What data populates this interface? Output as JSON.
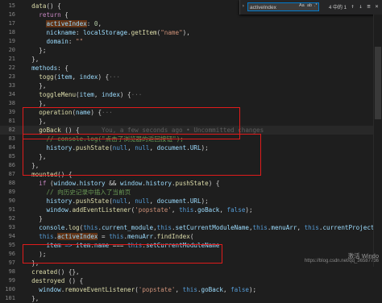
{
  "find": {
    "query": "activeIndex",
    "count": "4 中的 1",
    "opt_case": "Aa",
    "opt_word": "ab",
    "opt_regex": ".*",
    "prev": "↑",
    "next": "↓",
    "toggle_sel": "≡",
    "close": "×"
  },
  "lines": [
    {
      "n": "15",
      "tokens": [
        {
          "t": "  "
        },
        {
          "t": "data",
          "c": "fn"
        },
        {
          "t": "() {"
        }
      ]
    },
    {
      "n": "16",
      "tokens": [
        {
          "t": "    "
        },
        {
          "t": "return",
          "c": "kw"
        },
        {
          "t": " {"
        }
      ]
    },
    {
      "n": "17",
      "tokens": [
        {
          "t": "      "
        },
        {
          "t": "activeIndex",
          "c": "hl"
        },
        {
          "t": ": "
        },
        {
          "t": "0",
          "c": "num"
        },
        {
          "t": ","
        }
      ]
    },
    {
      "n": "18",
      "tokens": [
        {
          "t": "      "
        },
        {
          "t": "nickname",
          "c": "prop"
        },
        {
          "t": ": "
        },
        {
          "t": "localStorage",
          "c": "prop"
        },
        {
          "t": "."
        },
        {
          "t": "getItem",
          "c": "fn"
        },
        {
          "t": "("
        },
        {
          "t": "\"name\"",
          "c": "str"
        },
        {
          "t": "),"
        }
      ]
    },
    {
      "n": "19",
      "tokens": [
        {
          "t": "      "
        },
        {
          "t": "domain",
          "c": "prop"
        },
        {
          "t": ": "
        },
        {
          "t": "\"\"",
          "c": "str"
        }
      ]
    },
    {
      "n": "20",
      "tokens": [
        {
          "t": "    };"
        }
      ]
    },
    {
      "n": "21",
      "tokens": [
        {
          "t": "  },"
        }
      ]
    },
    {
      "n": "22",
      "tokens": [
        {
          "t": "  "
        },
        {
          "t": "methods",
          "c": "prop"
        },
        {
          "t": ": {"
        }
      ]
    },
    {
      "n": "23",
      "tokens": [
        {
          "t": "    "
        },
        {
          "t": "togg",
          "c": "fn"
        },
        {
          "t": "("
        },
        {
          "t": "item",
          "c": "prop"
        },
        {
          "t": ", "
        },
        {
          "t": "index",
          "c": "prop"
        },
        {
          "t": ") {"
        },
        {
          "t": "···",
          "c": "fold"
        }
      ]
    },
    {
      "n": "33",
      "tokens": [
        {
          "t": "    },"
        }
      ]
    },
    {
      "n": "34",
      "tokens": [
        {
          "t": "    "
        },
        {
          "t": "toggleMenu",
          "c": "fn"
        },
        {
          "t": "("
        },
        {
          "t": "item",
          "c": "prop"
        },
        {
          "t": ", "
        },
        {
          "t": "index",
          "c": "prop"
        },
        {
          "t": ") {"
        },
        {
          "t": "···",
          "c": "fold"
        }
      ]
    },
    {
      "n": "38",
      "tokens": [
        {
          "t": "    },"
        }
      ]
    },
    {
      "n": "39",
      "tokens": [
        {
          "t": "    "
        },
        {
          "t": "operation",
          "c": "fn"
        },
        {
          "t": "("
        },
        {
          "t": "name",
          "c": "prop"
        },
        {
          "t": ") {"
        },
        {
          "t": "···",
          "c": "fold"
        }
      ]
    },
    {
      "n": "81",
      "tokens": [
        {
          "t": "    },"
        }
      ]
    },
    {
      "n": "82",
      "tokens": [
        {
          "t": "    "
        },
        {
          "t": "goBack",
          "c": "fn"
        },
        {
          "t": " () {"
        },
        {
          "t": "      You, a few seconds ago • Uncommitted changes",
          "c": "blame"
        }
      ],
      "current": true
    },
    {
      "n": "83",
      "tokens": [
        {
          "t": "      "
        },
        {
          "t": "// console.log(\"点击了浏览器的返回按钮\");",
          "c": "cm"
        }
      ]
    },
    {
      "n": "84",
      "tokens": [
        {
          "t": "      "
        },
        {
          "t": "history",
          "c": "prop"
        },
        {
          "t": "."
        },
        {
          "t": "pushState",
          "c": "fn"
        },
        {
          "t": "("
        },
        {
          "t": "null",
          "c": "kb"
        },
        {
          "t": ", "
        },
        {
          "t": "null",
          "c": "kb"
        },
        {
          "t": ", "
        },
        {
          "t": "document",
          "c": "prop"
        },
        {
          "t": "."
        },
        {
          "t": "URL",
          "c": "prop"
        },
        {
          "t": ");"
        }
      ]
    },
    {
      "n": "85",
      "tokens": [
        {
          "t": "    },"
        }
      ]
    },
    {
      "n": "86",
      "tokens": [
        {
          "t": "  },"
        }
      ]
    },
    {
      "n": "87",
      "tokens": [
        {
          "t": "  "
        },
        {
          "t": "mounted",
          "c": "fn"
        },
        {
          "t": "() {"
        }
      ]
    },
    {
      "n": "88",
      "tokens": [
        {
          "t": "    "
        },
        {
          "t": "if",
          "c": "kw"
        },
        {
          "t": " ("
        },
        {
          "t": "window",
          "c": "prop"
        },
        {
          "t": "."
        },
        {
          "t": "history",
          "c": "prop"
        },
        {
          "t": " && "
        },
        {
          "t": "window",
          "c": "prop"
        },
        {
          "t": "."
        },
        {
          "t": "history",
          "c": "prop"
        },
        {
          "t": "."
        },
        {
          "t": "pushState",
          "c": "fn"
        },
        {
          "t": ") {"
        }
      ]
    },
    {
      "n": "89",
      "tokens": [
        {
          "t": "      "
        },
        {
          "t": "// 向历史记录中插入了当前页",
          "c": "cm"
        }
      ]
    },
    {
      "n": "90",
      "tokens": [
        {
          "t": "      "
        },
        {
          "t": "history",
          "c": "prop"
        },
        {
          "t": "."
        },
        {
          "t": "pushState",
          "c": "fn"
        },
        {
          "t": "("
        },
        {
          "t": "null",
          "c": "kb"
        },
        {
          "t": ", "
        },
        {
          "t": "null",
          "c": "kb"
        },
        {
          "t": ", "
        },
        {
          "t": "document",
          "c": "prop"
        },
        {
          "t": "."
        },
        {
          "t": "URL",
          "c": "prop"
        },
        {
          "t": ");"
        }
      ]
    },
    {
      "n": "91",
      "tokens": [
        {
          "t": "      "
        },
        {
          "t": "window",
          "c": "prop"
        },
        {
          "t": "."
        },
        {
          "t": "addEventListener",
          "c": "fn"
        },
        {
          "t": "("
        },
        {
          "t": "'popstate'",
          "c": "str"
        },
        {
          "t": ", "
        },
        {
          "t": "this",
          "c": "kb"
        },
        {
          "t": "."
        },
        {
          "t": "goBack",
          "c": "prop"
        },
        {
          "t": ", "
        },
        {
          "t": "false",
          "c": "kb"
        },
        {
          "t": ");"
        }
      ]
    },
    {
      "n": "92",
      "tokens": [
        {
          "t": "    }"
        }
      ]
    },
    {
      "n": "93",
      "tokens": [
        {
          "t": "    "
        },
        {
          "t": "console",
          "c": "prop"
        },
        {
          "t": "."
        },
        {
          "t": "log",
          "c": "fn"
        },
        {
          "t": "("
        },
        {
          "t": "this",
          "c": "kb"
        },
        {
          "t": "."
        },
        {
          "t": "current_module",
          "c": "prop"
        },
        {
          "t": ","
        },
        {
          "t": "this",
          "c": "kb"
        },
        {
          "t": "."
        },
        {
          "t": "setCurrentModuleName",
          "c": "prop"
        },
        {
          "t": ","
        },
        {
          "t": "this",
          "c": "kb"
        },
        {
          "t": "."
        },
        {
          "t": "menuArr",
          "c": "prop"
        },
        {
          "t": ", "
        },
        {
          "t": "this",
          "c": "kb"
        },
        {
          "t": "."
        },
        {
          "t": "currentProject",
          "c": "prop"
        },
        {
          "t": ");"
        }
      ]
    },
    {
      "n": "94",
      "tokens": [
        {
          "t": "    "
        },
        {
          "t": "this",
          "c": "kb"
        },
        {
          "t": "."
        },
        {
          "t": "activeIndex",
          "c": "hl"
        },
        {
          "t": " = "
        },
        {
          "t": "this",
          "c": "kb"
        },
        {
          "t": "."
        },
        {
          "t": "menuArr",
          "c": "prop"
        },
        {
          "t": "."
        },
        {
          "t": "findIndex",
          "c": "fn"
        },
        {
          "t": "("
        }
      ]
    },
    {
      "n": "95",
      "tokens": [
        {
          "t": "      "
        },
        {
          "t": "item",
          "c": "prop"
        },
        {
          "t": " "
        },
        {
          "t": "=>",
          "c": "kb"
        },
        {
          "t": " "
        },
        {
          "t": "item",
          "c": "prop"
        },
        {
          "t": "."
        },
        {
          "t": "name",
          "c": "prop"
        },
        {
          "t": " === "
        },
        {
          "t": "this",
          "c": "kb"
        },
        {
          "t": "."
        },
        {
          "t": "setCurrentModuleName",
          "c": "prop"
        }
      ]
    },
    {
      "n": "96",
      "tokens": [
        {
          "t": "    );"
        }
      ]
    },
    {
      "n": "97",
      "tokens": [
        {
          "t": "  },"
        }
      ]
    },
    {
      "n": "98",
      "tokens": [
        {
          "t": "  "
        },
        {
          "t": "created",
          "c": "fn"
        },
        {
          "t": "() {},"
        }
      ]
    },
    {
      "n": "99",
      "tokens": [
        {
          "t": "  "
        },
        {
          "t": "destroyed",
          "c": "fn"
        },
        {
          "t": " () {"
        }
      ]
    },
    {
      "n": "100",
      "tokens": [
        {
          "t": "    "
        },
        {
          "t": "window",
          "c": "prop"
        },
        {
          "t": "."
        },
        {
          "t": "removeEventListener",
          "c": "fn"
        },
        {
          "t": "("
        },
        {
          "t": "'popstate'",
          "c": "str"
        },
        {
          "t": ", "
        },
        {
          "t": "this",
          "c": "kb"
        },
        {
          "t": "."
        },
        {
          "t": "goBack",
          "c": "prop"
        },
        {
          "t": ", "
        },
        {
          "t": "false",
          "c": "kb"
        },
        {
          "t": ");"
        }
      ]
    },
    {
      "n": "101",
      "tokens": [
        {
          "t": "  },"
        }
      ]
    }
  ],
  "watermark": {
    "line1": "激活 Windo",
    "line2": "https://blog.csdn.net/qq_36587736"
  },
  "colors": {
    "background": "#1e1e1e",
    "annotation_box": "#e01b1b",
    "find_border": "#007acc"
  }
}
